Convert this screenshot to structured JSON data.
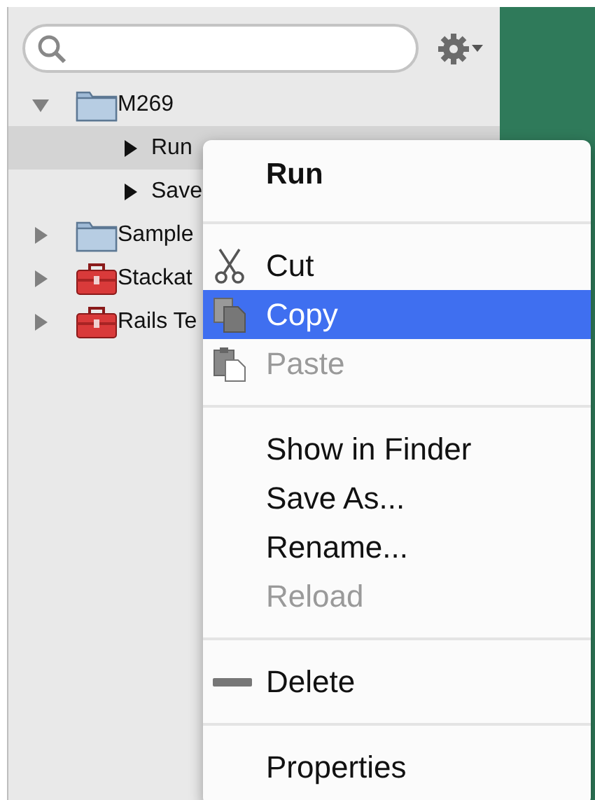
{
  "tree": [
    {
      "label": "M269",
      "kind": "folder",
      "expanded": true,
      "selected": false,
      "children": [
        {
          "label": "Run",
          "kind": "action",
          "expanded": false,
          "selected": true
        },
        {
          "label": "Save",
          "kind": "action",
          "expanded": false,
          "selected": false
        }
      ]
    },
    {
      "label": "Sample",
      "kind": "folder",
      "expanded": false,
      "selected": false
    },
    {
      "label": "Stackat",
      "kind": "toolbox",
      "expanded": false,
      "selected": false
    },
    {
      "label": "Rails Te",
      "kind": "toolbox",
      "expanded": false,
      "selected": false
    }
  ],
  "context_menu": [
    {
      "kind": "header",
      "label": "Run"
    },
    {
      "kind": "separator"
    },
    {
      "kind": "item",
      "label": "Cut",
      "disabled": false,
      "selected": false
    },
    {
      "kind": "item",
      "label": "Copy",
      "disabled": false,
      "selected": true
    },
    {
      "kind": "item",
      "label": "Paste",
      "disabled": true,
      "selected": false
    },
    {
      "kind": "separator"
    },
    {
      "kind": "item",
      "label": "Show in Finder",
      "disabled": false,
      "selected": false
    },
    {
      "kind": "item",
      "label": "Save As...",
      "disabled": false,
      "selected": false
    },
    {
      "kind": "item",
      "label": "Rename...",
      "disabled": false,
      "selected": false
    },
    {
      "kind": "item",
      "label": "Reload",
      "disabled": true,
      "selected": false
    },
    {
      "kind": "separator"
    },
    {
      "kind": "item",
      "label": "Delete",
      "disabled": false,
      "selected": false
    },
    {
      "kind": "separator"
    },
    {
      "kind": "item",
      "label": "Properties",
      "disabled": false,
      "selected": false
    }
  ]
}
